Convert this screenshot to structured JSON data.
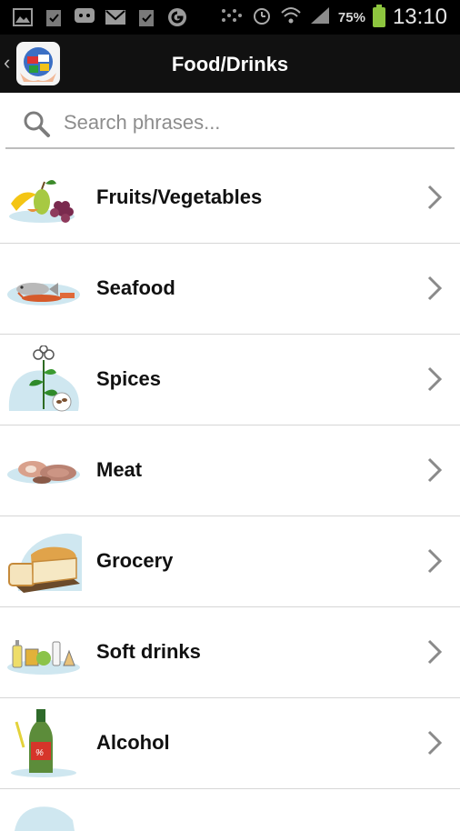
{
  "status_bar": {
    "battery_pct": "75%",
    "time": "13:10",
    "left_icons": [
      "image-icon",
      "clipboard-icon",
      "chat-icon",
      "gmail-icon",
      "clipboard-icon",
      "google-icon"
    ],
    "right_icons": [
      "dots-icon",
      "alarm-icon",
      "wifi-icon",
      "signal-icon",
      "battery-icon"
    ]
  },
  "action_bar": {
    "back_glyph": "‹",
    "title": "Food/Drinks",
    "logo_icon": "globe-hands-icon"
  },
  "search": {
    "placeholder": "Search phrases..."
  },
  "categories": [
    {
      "label": "Fruits/Vegetables",
      "icon": "fruits-icon"
    },
    {
      "label": "Seafood",
      "icon": "seafood-icon"
    },
    {
      "label": "Spices",
      "icon": "spices-icon"
    },
    {
      "label": "Meat",
      "icon": "meat-icon"
    },
    {
      "label": "Grocery",
      "icon": "bread-icon"
    },
    {
      "label": "Soft drinks",
      "icon": "soft-drinks-icon"
    },
    {
      "label": "Alcohol",
      "icon": "bottle-icon"
    }
  ],
  "colors": {
    "action_bar": "#111111",
    "battery": "#8dc53e",
    "divider": "#d6d6d6",
    "chevron": "#8a8a8a"
  }
}
